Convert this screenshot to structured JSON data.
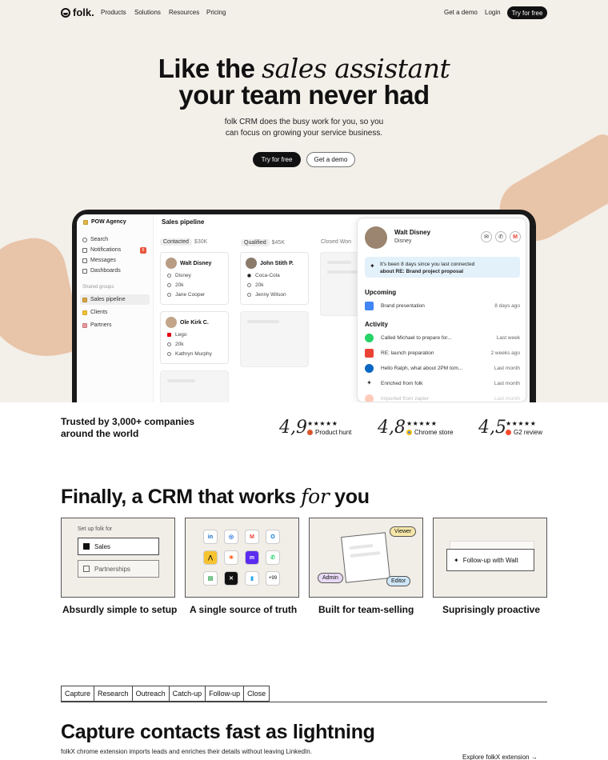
{
  "nav": {
    "brand": "folk.",
    "links": [
      "Products",
      "Solutions",
      "Resources",
      "Pricing"
    ],
    "demo": "Get a demo",
    "login": "Login",
    "cta": "Try for free"
  },
  "hero": {
    "line1_a": "Like the ",
    "line1_b": "sales assistant",
    "line2": "your team never had",
    "sub1": "folk CRM does the busy work for you, so you",
    "sub2": "can focus on growing your service business.",
    "cta": "Try for free",
    "demo": "Get a demo"
  },
  "app": {
    "workspace": "POW Agency",
    "nav": [
      "Search",
      "Notifications",
      "Messages",
      "Dashboards"
    ],
    "notifications_badge": "6",
    "shared_label": "Shared groups",
    "groups": [
      "Sales pipeline",
      "Clients",
      "Partners"
    ],
    "pipeline_title": "Sales pipeline",
    "columns": [
      {
        "status": "Contacted",
        "amount": "$30K"
      },
      {
        "status": "Qualified",
        "amount": "$45K"
      },
      {
        "status": "Closed Won",
        "amount": ""
      }
    ],
    "cards": [
      {
        "name": "Walt Disney",
        "company": "Disney",
        "value": "20k",
        "owner": "Jane Cooper"
      },
      {
        "name": "John Stith P.",
        "company": "Coca-Cola",
        "value": "20k",
        "owner": "Jenny Wilson"
      },
      {
        "name": "Ole Kirk C.",
        "company": "Lego",
        "value": "20k",
        "owner": "Kathryn Murphy"
      }
    ]
  },
  "panel": {
    "name": "Walt Disney",
    "company": "Disney",
    "note_line1": "It's been 8 days since you last connected",
    "note_line2": "about RE: Brand project proposal",
    "upcoming_title": "Upcoming",
    "upcoming": {
      "label": "Brand presentation",
      "time": "8 days ago"
    },
    "activity_title": "Activity",
    "activity": [
      {
        "label": "Called Michael to prepare for...",
        "time": "Last week",
        "color": "#25d366"
      },
      {
        "label": "RE: launch preparation",
        "time": "2 weeks ago",
        "color": "#ea4335"
      },
      {
        "label": "Hello Ralph, what about 2PM tom...",
        "time": "Last month",
        "color": "#0a66c2"
      },
      {
        "label": "Enriched from folk",
        "time": "Last month",
        "color": "#111111"
      },
      {
        "label": "Imported from zapier",
        "time": "Last month",
        "color": "#ff6a3d"
      }
    ]
  },
  "trust": {
    "line1": "Trusted by 3,000+ companies",
    "line2": "around the world",
    "ratings": [
      {
        "score": "4,9",
        "stars": "★★★★★",
        "source": "Product hunt",
        "color": "#da552f"
      },
      {
        "score": "4,8",
        "stars": "★★★★★",
        "source": "Chrome store",
        "color": "#4285f4"
      },
      {
        "score": "4,5",
        "stars": "★★★★★",
        "source": "G2 review",
        "color": "#ff492c"
      }
    ]
  },
  "features": {
    "title_a": "Finally, a CRM that works ",
    "title_b": "for",
    "title_c": " you",
    "setup_label": "Set up folk for",
    "setup_opts": [
      "Sales",
      "Partnerships"
    ],
    "apps": [
      "in",
      "◎",
      "M",
      "O",
      "⋀",
      "✳",
      "m",
      "✆",
      "▤",
      "✕",
      "▮",
      "+99"
    ],
    "tags": [
      "Viewer",
      "Admin",
      "Editor"
    ],
    "followup": "Follow-up with Walt",
    "labels": [
      "Absurdly simple to setup",
      "A single source of truth",
      "Built for team-selling",
      "Suprisingly proactive"
    ]
  },
  "tabs": [
    "Capture",
    "Research",
    "Outreach",
    "Catch-up",
    "Follow-up",
    "Close"
  ],
  "capture": {
    "title": "Capture contacts fast as lightning",
    "desc": "folkX chrome extension imports leads and enriches their details without leaving LinkedIn.",
    "link": "Explore folkX extension →"
  }
}
